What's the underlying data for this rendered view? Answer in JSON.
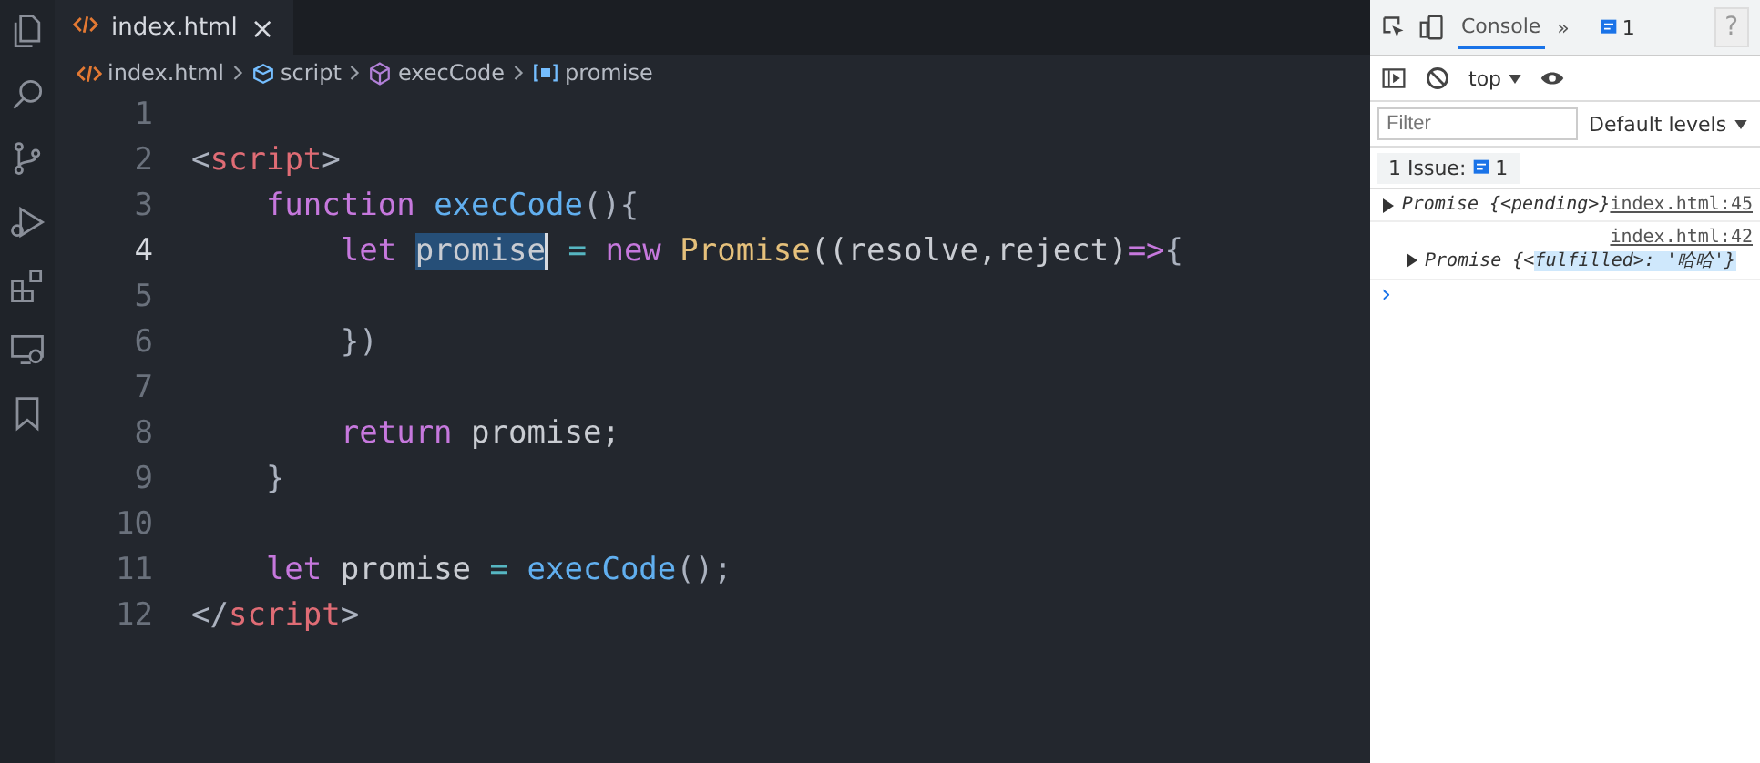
{
  "editor": {
    "tab": {
      "label": "index.html",
      "close": "×"
    },
    "breadcrumbs": [
      {
        "kind": "file",
        "label": "index.html"
      },
      {
        "kind": "module",
        "label": "script"
      },
      {
        "kind": "function",
        "label": "execCode"
      },
      {
        "kind": "variable",
        "label": "promise"
      }
    ],
    "lines": [
      {
        "number": "1",
        "active": false
      },
      {
        "number": "2",
        "active": false,
        "tokens": [
          {
            "text": "<",
            "kind": "punct"
          },
          {
            "text": "script",
            "kind": "tag"
          },
          {
            "text": ">",
            "kind": "punct"
          }
        ]
      },
      {
        "number": "3",
        "active": false,
        "tokens": [
          {
            "text": "    function ",
            "kind": "keyword"
          },
          {
            "text": "execCode",
            "kind": "func"
          },
          {
            "text": "(){",
            "kind": "punct"
          }
        ]
      },
      {
        "number": "4",
        "active": true,
        "tokens": [
          {
            "text": "        let ",
            "kind": "keyword"
          },
          {
            "text": "promise",
            "kind": "plain",
            "selected": true
          },
          {
            "text": " = ",
            "kind": "operator"
          },
          {
            "text": "new ",
            "kind": "keyword"
          },
          {
            "text": "Promise",
            "kind": "class"
          },
          {
            "text": "((resolve,reject)",
            "kind": "plain"
          },
          {
            "text": "=>",
            "kind": "keyword"
          },
          {
            "text": "{",
            "kind": "punct"
          }
        ]
      },
      {
        "number": "5",
        "active": false
      },
      {
        "number": "6",
        "active": false,
        "tokens": [
          {
            "text": "        })",
            "kind": "punct"
          }
        ]
      },
      {
        "number": "7",
        "active": false
      },
      {
        "number": "8",
        "active": false,
        "tokens": [
          {
            "text": "        return ",
            "kind": "keyword"
          },
          {
            "text": "promise;",
            "kind": "plain"
          }
        ]
      },
      {
        "number": "9",
        "active": false,
        "tokens": [
          {
            "text": "    }",
            "kind": "punct"
          }
        ]
      },
      {
        "number": "10",
        "active": false
      },
      {
        "number": "11",
        "active": false,
        "tokens": [
          {
            "text": "    let ",
            "kind": "keyword"
          },
          {
            "text": "promise",
            "kind": "plain"
          },
          {
            "text": " = ",
            "kind": "operator"
          },
          {
            "text": "execCode",
            "kind": "func"
          },
          {
            "text": "();",
            "kind": "punct"
          }
        ]
      },
      {
        "number": "12",
        "active": false,
        "tokens": [
          {
            "text": "</",
            "kind": "punct"
          },
          {
            "text": "script",
            "kind": "tag"
          },
          {
            "text": ">",
            "kind": "punct"
          }
        ]
      }
    ]
  },
  "devtools": {
    "tabs": [
      {
        "label": "Console",
        "selected": true
      }
    ],
    "more": "»",
    "issue_count": "1",
    "help": "?",
    "context": "top",
    "filter": {
      "placeholder": "Filter"
    },
    "levels": "Default levels",
    "issues": {
      "label": "1 Issue:",
      "count": "1"
    },
    "messages": [
      {
        "text": "Promise {<pending>}",
        "link": "index.html:45",
        "link_above": false
      },
      {
        "text": "Promise {<",
        "highlight": "fulfilled>: '哈哈'}",
        "link": "index.html:42",
        "link_above": true
      }
    ],
    "prompt": "›"
  }
}
